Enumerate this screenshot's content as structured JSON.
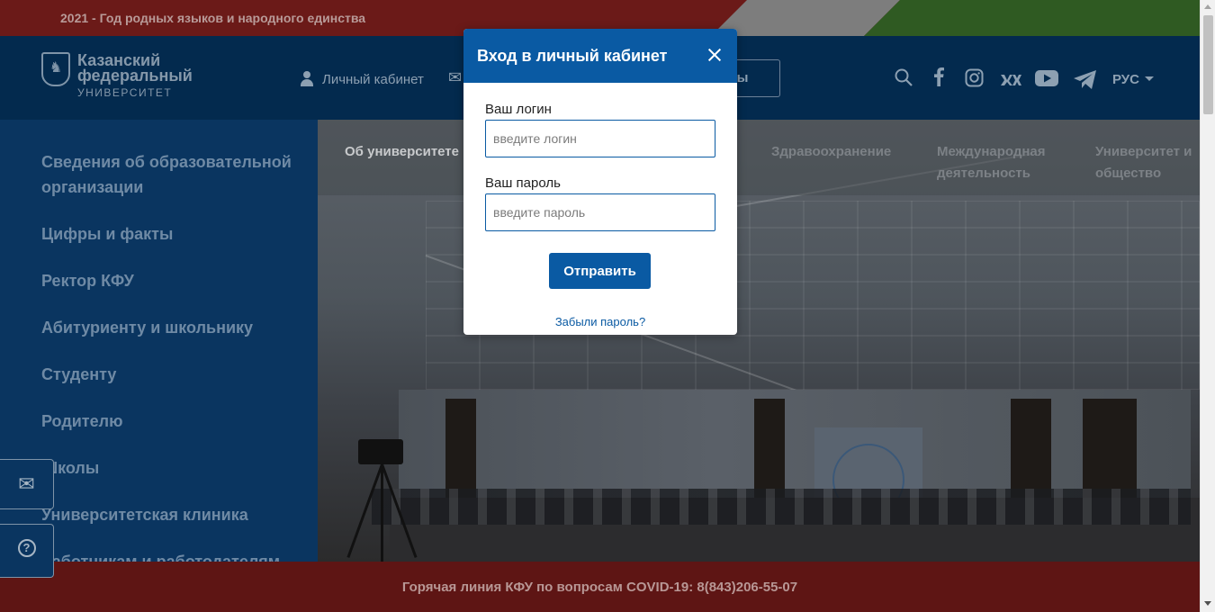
{
  "top_banner": {
    "text": "2021 - Год родных языков и народного единства"
  },
  "header": {
    "logo_line1": "Казанский",
    "logo_line2": "федеральный",
    "logo_line3": "УНИВЕРСИТЕТ",
    "personal_cabinet": "Личный кабинет",
    "mail_icon": "envelope-icon",
    "institutes_partial": "туты",
    "socials": [
      "search-icon",
      "facebook-icon",
      "instagram-icon",
      "vk-icon",
      "youtube-icon",
      "telegram-icon"
    ],
    "lang": "РУС"
  },
  "left_menu": {
    "items": [
      "Сведения об образовательной организации",
      "Цифры и факты",
      "Ректор КФУ",
      "Абитуриенту и школьнику",
      "Студенту",
      "Родителю",
      "Школы",
      "Университетская клиника",
      "Работникам и работодателям"
    ]
  },
  "hero_nav": {
    "items": [
      "Об университете",
      "Здравоохранение",
      "Международная деятельность",
      "Университет и общество"
    ]
  },
  "bottom_banner": {
    "text": "Горячая линия КФУ по вопросам COVID-19: 8(843)206-55-07"
  },
  "login_modal": {
    "title": "Вход в личный кабинет",
    "login_label": "Ваш логин",
    "login_placeholder": "введите логин",
    "login_value": "",
    "password_label": "Ваш пароль",
    "password_placeholder": "введите пароль",
    "password_value": "",
    "submit_label": "Отправить",
    "forgot_link": "Забыли пароль?"
  },
  "colors": {
    "primary_blue": "#0a5aa3",
    "header_navy": "#032a4e",
    "banner_red": "#6b1a18"
  }
}
